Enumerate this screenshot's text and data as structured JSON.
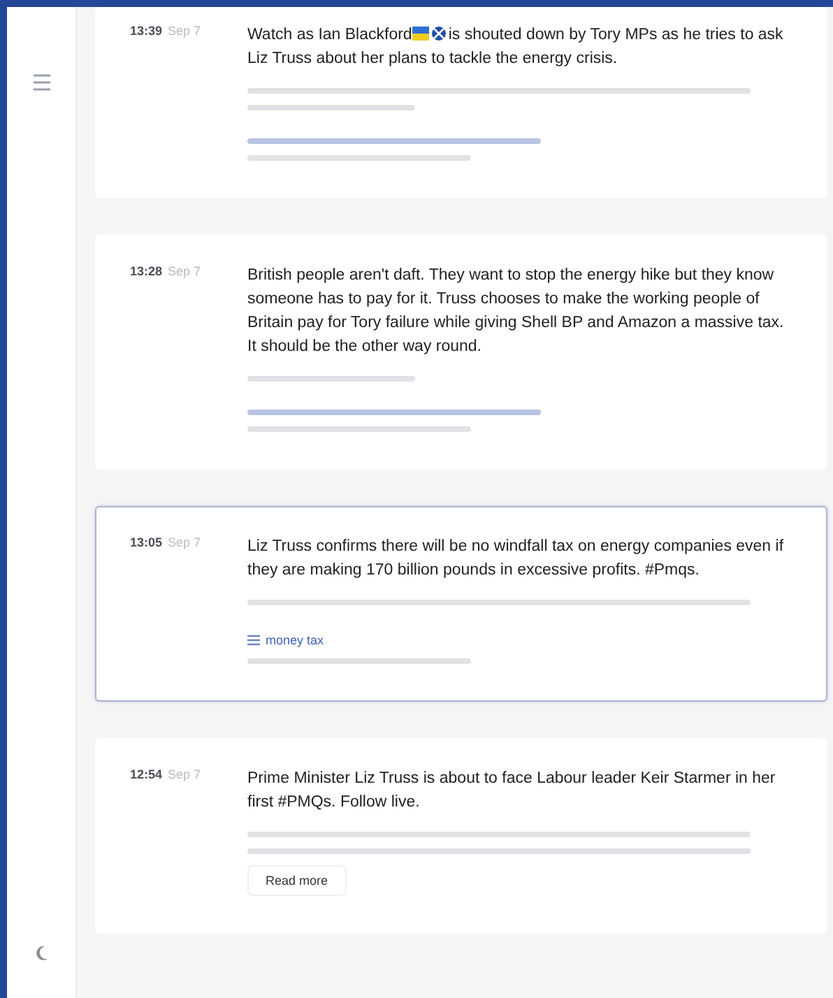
{
  "posts": [
    {
      "time": "13:39",
      "day": "Sep 7",
      "selected": false,
      "parts": [
        {
          "kind": "text",
          "text": "Watch as Ian Blackford"
        },
        {
          "kind": "flags"
        },
        {
          "kind": "text",
          "text": "is shouted down by Tory MPs as he tries to ask Liz Truss about her plans to tackle the energy crisis."
        }
      ]
    },
    {
      "time": "13:28",
      "day": "Sep 7",
      "selected": false,
      "parts": [
        {
          "kind": "text",
          "text": "British people aren't daft. They want to stop the energy hike but they know someone has to pay for it. Truss chooses to make the working people of Britain pay for Tory failure while giving Shell BP and Amazon a massive tax. It should be the other way round."
        }
      ]
    },
    {
      "time": "13:05",
      "day": "Sep 7",
      "selected": true,
      "parts": [
        {
          "kind": "text",
          "text": "Liz Truss confirms there will be no windfall tax on energy companies even if they are making 170 billion pounds in excessive profits. #Pmqs."
        }
      ],
      "tag": "money tax"
    },
    {
      "time": "12:54",
      "day": "Sep 7",
      "selected": false,
      "parts": [
        {
          "kind": "text",
          "text": "Prime Minister Liz Truss is about to face Labour leader Keir Starmer in her first #PMQs. Follow live."
        }
      ],
      "button": "Read more"
    }
  ]
}
